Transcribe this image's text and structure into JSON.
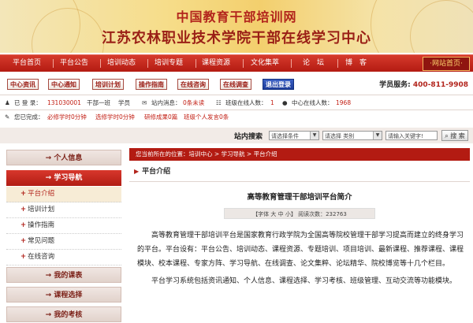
{
  "banner": {
    "line1": "中国教育干部培训网",
    "line2": "江苏农林职业技术学院干部在线学习中心"
  },
  "nav": {
    "items": [
      "平台首页",
      "平台公告",
      "培训动态",
      "培训专题",
      "课程资源",
      "文化集萃",
      "论　坛",
      "博　客"
    ],
    "home_label": "·网站首页·"
  },
  "buttons": [
    "中心资讯",
    "中心通知",
    "培训计划",
    "操作指南",
    "在线咨询",
    "在线调查",
    "退出登录"
  ],
  "hotline": {
    "label": "学员服务:",
    "number": "400-811-9908"
  },
  "status": {
    "login_label": "已 登 录：",
    "user_id": "131030001",
    "class_name": "干部一班",
    "role": "学员",
    "inbox_label": "站内消息：",
    "inbox_value": "0条未读",
    "class_online_label": "班级在线人数：",
    "class_online_value": "1",
    "center_online_label": "中心在线人数：",
    "center_online_value": "1968"
  },
  "progress": {
    "label": "您已完成：",
    "required": "必修学时0分钟",
    "elective": "选修学时0分钟",
    "research": "研修成果0篇",
    "class_speech": "班级个人发言0条"
  },
  "search": {
    "label": "站内搜索",
    "condition_placeholder": "请选择条件",
    "category_placeholder": "请选择 类别",
    "keyword_placeholder": "请输入关键字!",
    "button_label": "搜 索"
  },
  "sidebar": {
    "personal": "→ 个人信息",
    "guide": "→ 学习导航",
    "guide_items": [
      "平台介绍",
      "培训计划",
      "操作指南",
      "常见问题",
      "在线咨询"
    ],
    "my_courses": "→ 我的课表",
    "course_select": "→ 课程选择",
    "my_exam": "→ 我的考核"
  },
  "breadcrumb": "您当前所在的位置：培训中心 > 学习导航 > 平台介绍",
  "section_title": "平台介绍",
  "article": {
    "title": "高等教育管理干部培训平台简介",
    "font_size_line": "【字体 大 中 小】 阅读次数：232763",
    "p1": "高等教育管理干部培训平台是国家教育行政学院为全国高等院校管理干部学习提高而建立的终身学习的平台。平台设有：平台公告、培训动态、课程资源、专题培训、项目培训、最新课程、推荐课程、课程模块、校本课程、专家方阵、学习导航、在线调查、论文集粹、论坛精华、院校博览等十几个栏目。",
    "p2": "平台学习系统包括资讯通知、个人信息、课程选择、学习考核、班级管理、互动交流等功能模块。"
  },
  "colors": {
    "brand_red": "#b31b12",
    "banner_gold": "#f3cf6d",
    "logout_blue": "#1d3c9a"
  }
}
